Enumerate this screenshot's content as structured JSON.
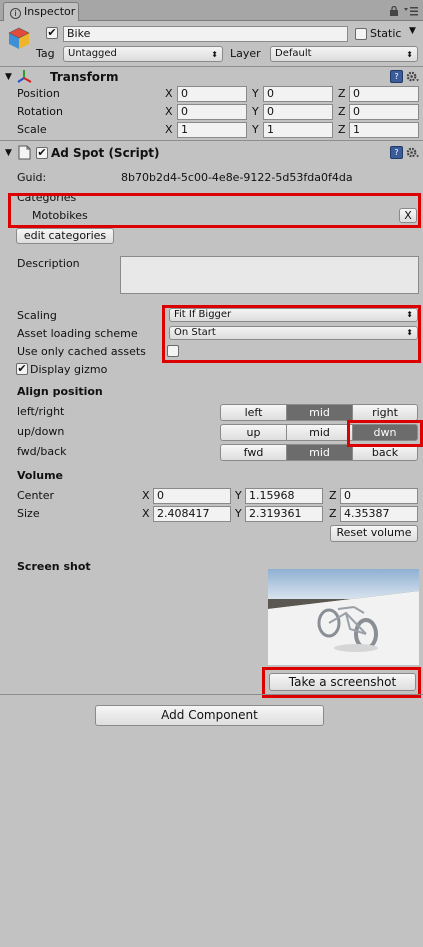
{
  "window": {
    "tab_label": "Inspector",
    "tab_icon": "info-icon"
  },
  "object": {
    "name": "Bike",
    "active": true,
    "static_label": "Static",
    "static": false,
    "tag_label": "Tag",
    "tag_value": "Untagged",
    "layer_label": "Layer",
    "layer_value": "Default"
  },
  "transform": {
    "title": "Transform",
    "rows": [
      {
        "label": "Position",
        "x": "0",
        "y": "0",
        "z": "0"
      },
      {
        "label": "Rotation",
        "x": "0",
        "y": "0",
        "z": "0"
      },
      {
        "label": "Scale",
        "x": "1",
        "y": "1",
        "z": "1"
      }
    ],
    "axis_x": "X",
    "axis_y": "Y",
    "axis_z": "Z"
  },
  "adspot": {
    "title": "Ad Spot (Script)",
    "enabled": true,
    "guid_label": "Guid:",
    "guid_value": "8b70b2d4-5c00-4e8e-9122-5d53fda0f4da",
    "categories_label": "Categories",
    "category_item": "Motobikes",
    "remove_label": "X",
    "edit_categories_label": "edit categories",
    "description_label": "Description",
    "description_value": "",
    "scaling_label": "Scaling",
    "scaling_value": "Fit If Bigger",
    "loading_label": "Asset loading scheme",
    "loading_value": "On Start",
    "cached_label": "Use only cached assets",
    "cached": false,
    "gizmo_label": "Display gizmo",
    "gizmo": true,
    "align_title": "Align position",
    "align_rows": [
      {
        "label": "left/right",
        "options": [
          "left",
          "mid",
          "right"
        ],
        "selected": "mid"
      },
      {
        "label": "up/down",
        "options": [
          "up",
          "mid",
          "dwn"
        ],
        "selected": "dwn"
      },
      {
        "label": "fwd/back",
        "options": [
          "fwd",
          "mid",
          "back"
        ],
        "selected": "mid"
      }
    ],
    "volume_title": "Volume",
    "center_label": "Center",
    "center": {
      "x": "0",
      "y": "1.15968",
      "z": "0"
    },
    "size_label": "Size",
    "size": {
      "x": "2.408417",
      "y": "2.319361",
      "z": "4.35387"
    },
    "reset_volume_label": "Reset volume",
    "screenshot_title": "Screen shot",
    "take_screenshot_label": "Take a screenshot"
  },
  "add_component_label": "Add Component",
  "colors": {
    "background": "#c2c2c2",
    "highlight": "#dd0000",
    "segment_selected": "#6c6c6c"
  }
}
